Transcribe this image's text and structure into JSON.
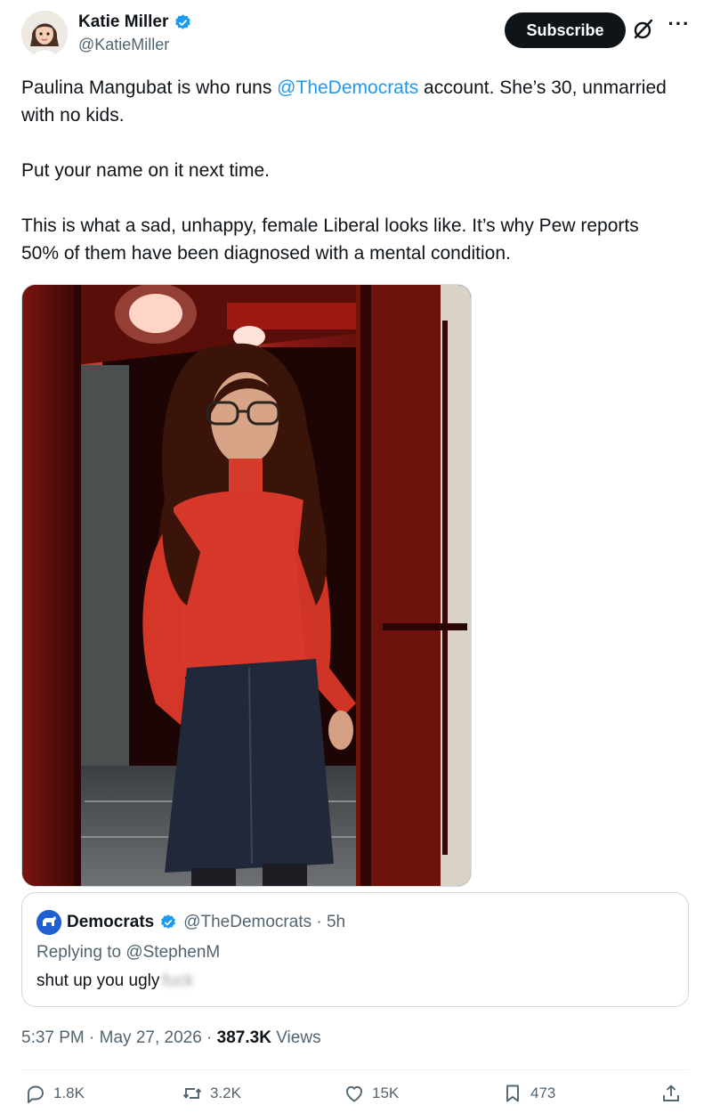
{
  "author": {
    "display_name": "Katie Miller",
    "handle": "@KatieMiller",
    "verified": true
  },
  "header": {
    "subscribe_label": "Subscribe",
    "more_label": "···"
  },
  "tweet": {
    "paragraphs": {
      "p1_before": "Paulina Mangubat is who runs ",
      "p1_mention": "@TheDemocrats",
      "p1_after": " account. She’s 30, unmarried with no kids.",
      "p2": "Put your name on it next time.",
      "p3": "This is what a sad, unhappy, female Liberal looks like. It’s why Pew reports 50% of them have been diagnosed with a mental condition."
    }
  },
  "quote": {
    "display_name": "Democrats",
    "handle_time": "@TheDemocrats · 5h",
    "replying_to": "Replying to @StephenM",
    "text": "shut up you ugly",
    "blurred_text": "fuck"
  },
  "meta": {
    "time_date": "5:37 PM · May 27, 2026 · ",
    "views_count": "387.3K",
    "views_label": " Views"
  },
  "actions": {
    "replies": "1.8K",
    "reposts": "3.2K",
    "likes": "15K",
    "bookmarks": "473"
  },
  "colors": {
    "accent": "#1d9bf0",
    "text": "#0f1419",
    "muted": "#536471"
  }
}
